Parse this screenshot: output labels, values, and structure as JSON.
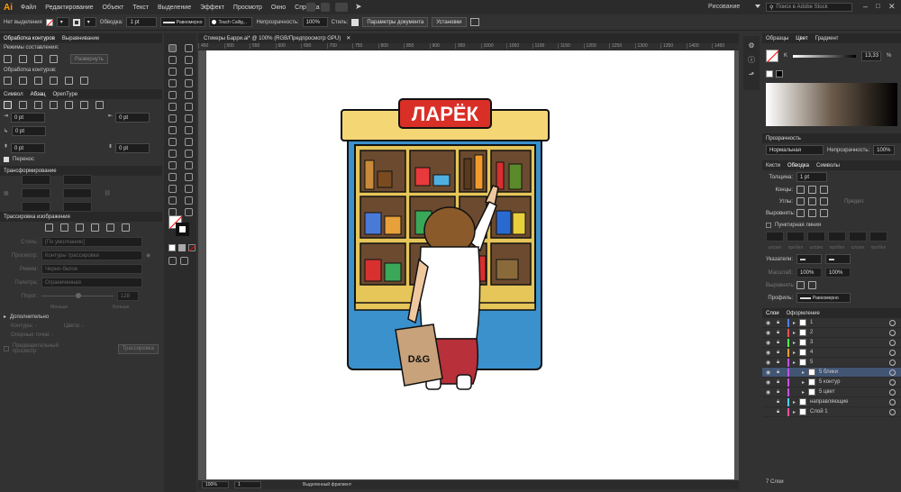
{
  "app": {
    "logo": "Ai",
    "search_placeholder": "Поиск в Adobe Stock",
    "workspace": "Рисование"
  },
  "menu": [
    "Файл",
    "Редактирование",
    "Объект",
    "Текст",
    "Выделение",
    "Эффект",
    "Просмотр",
    "Окно",
    "Справка"
  ],
  "control": {
    "selection": "Нет выделения",
    "stroke_label": "Обводка:",
    "stroke_value": "1 pt",
    "profile": "Равномерно",
    "brush": "Touch Callig...",
    "opacity_label": "Непрозрачность:",
    "opacity_value": "100%",
    "style_label": "Стиль:",
    "doc_settings": "Параметры документа",
    "prefs": "Установки"
  },
  "left": {
    "pathfinder_tabs": [
      "Обработка контуров",
      "Выравнивание"
    ],
    "shape_modes": "Режимы составления:",
    "expand": "Развернуть",
    "pathfinders": "Обработка контуров:",
    "text_tabs": [
      "Символ",
      "Абзац",
      "OpenType"
    ],
    "indent": [
      "0 pt",
      "0 pt",
      "0 pt",
      "0 pt",
      "0 pt"
    ],
    "hyphen": "Перенос",
    "transform_title": "Трансформирование",
    "trace_title": "Трассировка изображения",
    "trace_rows": [
      {
        "label": "Стиль:",
        "value": "[По умолчанию]"
      },
      {
        "label": "Просмотр:",
        "value": "Контуры трассировки"
      },
      {
        "label": "Режим:",
        "value": "Черно-белое"
      },
      {
        "label": "Палитра:",
        "value": "Ограниченная"
      },
      {
        "label": "Порог:",
        "value": "128"
      }
    ],
    "trace_slider_min": "Меньше",
    "trace_slider_max": "Больше",
    "advanced": "Дополнительно",
    "stats": [
      "Контуры: -",
      "Опорные точки: -",
      "Цвета: -"
    ],
    "preview": "Предварительный просмотр",
    "trace_button": "Трассировка"
  },
  "document": {
    "tab": "Стикеры Барри.ai* @ 100% (RGB/Предпросмотр GPU)",
    "ruler": [
      "450",
      "500",
      "550",
      "600",
      "650",
      "700",
      "750",
      "800",
      "850",
      "900",
      "950",
      "1000",
      "1050",
      "1100",
      "1150",
      "1200",
      "1250",
      "1300",
      "1350",
      "1400",
      "1450"
    ],
    "sign": "ЛАРЁК",
    "bag": "D&G",
    "zoom": "100%",
    "page": "1",
    "status": "Выделенный фрагмент"
  },
  "right": {
    "color_tabs": [
      "Образцы",
      "Цвет",
      "Градиент"
    ],
    "k_label": "K",
    "k_value": "13,33",
    "transparency_title": "Прозрачность",
    "blend": "Нормальная",
    "opacity_label": "Непрозрачность:",
    "opacity_value": "100%",
    "stroke_tabs": [
      "Кисти",
      "Обводка",
      "Символы"
    ],
    "weight_label": "Толщина:",
    "weight_value": "1 pt",
    "cap_label": "Концы:",
    "corner_label": "Углы:",
    "limit_label": "Предел:",
    "align_label": "Выровнять:",
    "dashed": "Пунктирная линия",
    "dash_labels": [
      "штрих",
      "пробел",
      "штрих",
      "пробел",
      "штрих",
      "пробел"
    ],
    "arrow_label": "Указатели:",
    "scale_label": "Масштаб:",
    "scale_values": [
      "100%",
      "100%"
    ],
    "align2_label": "Выровнять:",
    "profile_label": "Профиль:",
    "profile_value": "Равномерно",
    "layers_tabs": [
      "Слои",
      "Оформление"
    ],
    "layers": [
      {
        "name": "1",
        "color": "#4f7fff"
      },
      {
        "name": "2",
        "color": "#ff4f4f"
      },
      {
        "name": "3",
        "color": "#4fff4f"
      },
      {
        "name": "4",
        "color": "#ff9a2f"
      },
      {
        "name": "5",
        "color": "#c84fff"
      },
      {
        "name": "5 блики",
        "color": "#c84fff"
      },
      {
        "name": "5 контур",
        "color": "#c84fff"
      },
      {
        "name": "5 цвет",
        "color": "#c84fff"
      },
      {
        "name": "направляющие",
        "color": "#4fcfff"
      },
      {
        "name": "Слой 1",
        "color": "#ff4f9a"
      }
    ],
    "layers_count": "7 Слои"
  }
}
